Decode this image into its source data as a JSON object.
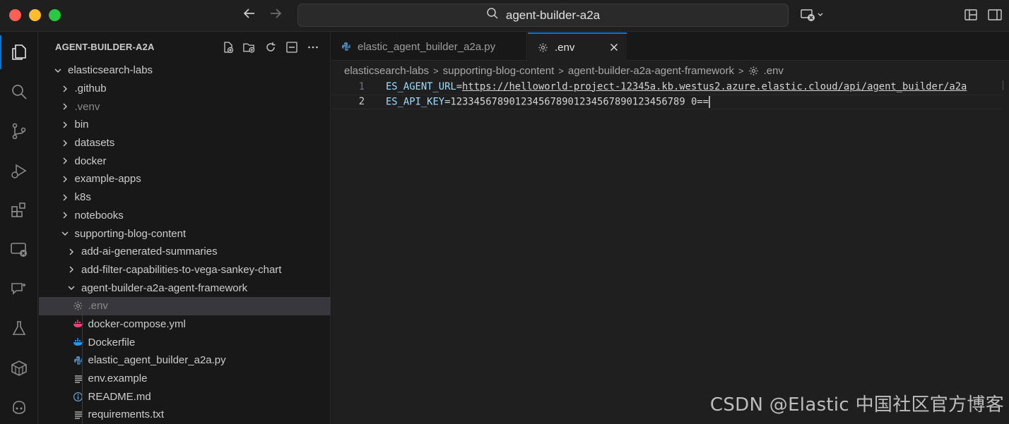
{
  "window": {
    "search_text": "agent-builder-a2a"
  },
  "sidebar": {
    "title": "AGENT-BUILDER-A2A",
    "tree": [
      {
        "label": "elasticsearch-labs",
        "depth": 0,
        "expanded": true,
        "type": "folder"
      },
      {
        "label": ".github",
        "depth": 1,
        "expanded": false,
        "type": "folder"
      },
      {
        "label": ".venv",
        "depth": 1,
        "expanded": false,
        "type": "folder",
        "dim": true
      },
      {
        "label": "bin",
        "depth": 1,
        "expanded": false,
        "type": "folder"
      },
      {
        "label": "datasets",
        "depth": 1,
        "expanded": false,
        "type": "folder"
      },
      {
        "label": "docker",
        "depth": 1,
        "expanded": false,
        "type": "folder"
      },
      {
        "label": "example-apps",
        "depth": 1,
        "expanded": false,
        "type": "folder"
      },
      {
        "label": "k8s",
        "depth": 1,
        "expanded": false,
        "type": "folder"
      },
      {
        "label": "notebooks",
        "depth": 1,
        "expanded": false,
        "type": "folder"
      },
      {
        "label": "supporting-blog-content",
        "depth": 1,
        "expanded": true,
        "type": "folder"
      },
      {
        "label": "add-ai-generated-summaries",
        "depth": 2,
        "expanded": false,
        "type": "folder"
      },
      {
        "label": "add-filter-capabilities-to-vega-sankey-chart",
        "depth": 2,
        "expanded": false,
        "type": "folder"
      },
      {
        "label": "agent-builder-a2a-agent-framework",
        "depth": 2,
        "expanded": true,
        "type": "folder"
      },
      {
        "label": ".env",
        "depth": 3,
        "type": "file",
        "icon": "gear-icon",
        "selected": true,
        "dim": true
      },
      {
        "label": "docker-compose.yml",
        "depth": 3,
        "type": "file",
        "icon": "docker-compose-icon"
      },
      {
        "label": "Dockerfile",
        "depth": 3,
        "type": "file",
        "icon": "docker-icon"
      },
      {
        "label": "elastic_agent_builder_a2a.py",
        "depth": 3,
        "type": "file",
        "icon": "python-icon"
      },
      {
        "label": "env.example",
        "depth": 3,
        "type": "file",
        "icon": "lines-icon"
      },
      {
        "label": "README.md",
        "depth": 3,
        "type": "file",
        "icon": "info-icon"
      },
      {
        "label": "requirements.txt",
        "depth": 3,
        "type": "file",
        "icon": "lines-icon"
      }
    ]
  },
  "editor": {
    "tabs": [
      {
        "label": "elastic_agent_builder_a2a.py",
        "icon": "python-icon",
        "active": false
      },
      {
        "label": ".env",
        "icon": "gear-icon",
        "active": true
      }
    ],
    "breadcrumb": [
      "elasticsearch-labs",
      "supporting-blog-content",
      "agent-builder-a2a-agent-framework",
      ".env"
    ],
    "lines": [
      {
        "num": "1",
        "key": "ES_AGENT_URL",
        "eq": "=",
        "value": "https://helloworld-project-12345a.kb.westus2.azure.elastic.cloud/api/agent_builder/a2a",
        "value_is_link": true
      },
      {
        "num": "2",
        "key": "ES_API_KEY",
        "eq": "=",
        "value": "1233456789012345678901234567890123456789 0==",
        "value_is_link": false
      }
    ]
  },
  "watermark": "CSDN @Elastic 中国社区官方博客",
  "colors": {
    "accent": "#0078d4",
    "key": "#9cdcfe",
    "string": "#ce9178",
    "python": "#4b8bbe",
    "docker": "#2496ed",
    "compose": "#e0457b"
  }
}
